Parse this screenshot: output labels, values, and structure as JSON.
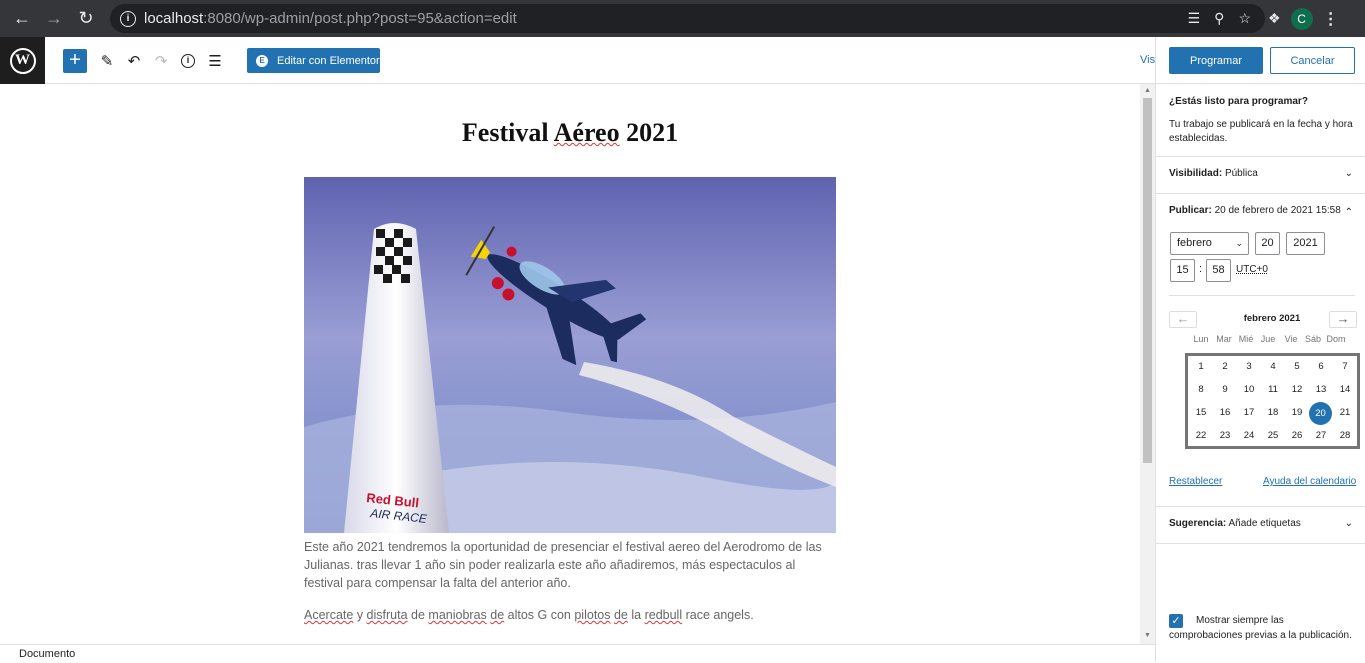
{
  "browser": {
    "url_host": "localhost",
    "url_rest": ":8080/wp-admin/post.php?post=95&action=edit",
    "profile_initial": "C"
  },
  "toolbar": {
    "elementor_label": "Editar con Elementor",
    "view_link": "Vist"
  },
  "post": {
    "title_parts": [
      "Festival ",
      "Aéreo",
      " 2021"
    ],
    "paragraph1": "Este año 2021 tendremos la oportunidad de presenciar el festival aereo del Aerodromo de las Julianas. tras llevar 1 año sin poder realizarla este año añadiremos, más espectaculos al festival para compensar la falta del anterior año.",
    "paragraph2_words": [
      "Acercate",
      " y ",
      "disfruta",
      " de ",
      "maniobras",
      " ",
      "de",
      " altos G con ",
      "pilotos",
      " ",
      "de",
      " la ",
      "redbull",
      " race angels."
    ],
    "image_text": "Red Bull AIR RACE"
  },
  "footer": {
    "breadcrumb": "Documento"
  },
  "sidebar": {
    "schedule_button": "Programar",
    "cancel_button": "Cancelar",
    "question": "¿Estás listo para programar?",
    "description": "Tu trabajo se publicará en la fecha y hora establecidas.",
    "visibility_label": "Visibilidad:",
    "visibility_value": "Pública",
    "publish_label": "Publicar:",
    "publish_value": "20 de febrero de 2021 15:58",
    "month_select": "febrero",
    "day": "20",
    "year": "2021",
    "hour": "15",
    "minute": "58",
    "timezone": "UTC+0",
    "calendar_month": "febrero 2021",
    "weekdays": [
      "Lun",
      "Mar",
      "Mié",
      "Jue",
      "Vie",
      "Sáb",
      "Dom"
    ],
    "days": [
      "1",
      "2",
      "3",
      "4",
      "5",
      "6",
      "7",
      "8",
      "9",
      "10",
      "11",
      "12",
      "13",
      "14",
      "15",
      "16",
      "17",
      "18",
      "19",
      "20",
      "21",
      "22",
      "23",
      "24",
      "25",
      "26",
      "27",
      "28"
    ],
    "selected_day": "20",
    "reset_link": "Restablecer",
    "help_link": "Ayuda del calendario",
    "suggestion_label": "Sugerencia:",
    "suggestion_value": "Añade etiquetas",
    "checkbox_label": "Mostrar siempre las comprobaciones previas a la publicación.",
    "checkbox_checked": true
  },
  "colors": {
    "accent": "#2271b1",
    "chrome_bar": "#35363a",
    "spellcheck": "#d63638"
  }
}
